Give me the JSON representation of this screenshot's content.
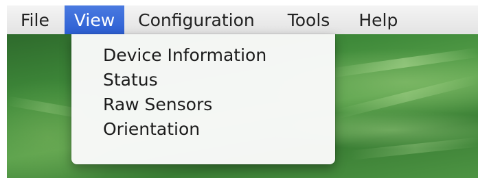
{
  "menubar": {
    "items": [
      {
        "label": "File",
        "active": false
      },
      {
        "label": "View",
        "active": true
      },
      {
        "label": "Configuration",
        "active": false
      },
      {
        "label": "Tools",
        "active": false
      },
      {
        "label": "Help",
        "active": false
      }
    ]
  },
  "view_menu": {
    "items": [
      {
        "label": "Device Information"
      },
      {
        "label": "Status"
      },
      {
        "label": "Raw Sensors"
      },
      {
        "label": "Orientation"
      }
    ]
  },
  "colors": {
    "menu_highlight": "#2c5fd3",
    "menubar_bg": "#e9e9e9",
    "dropdown_bg": "#fafafa",
    "wallpaper_green": "#3f8a3a"
  }
}
